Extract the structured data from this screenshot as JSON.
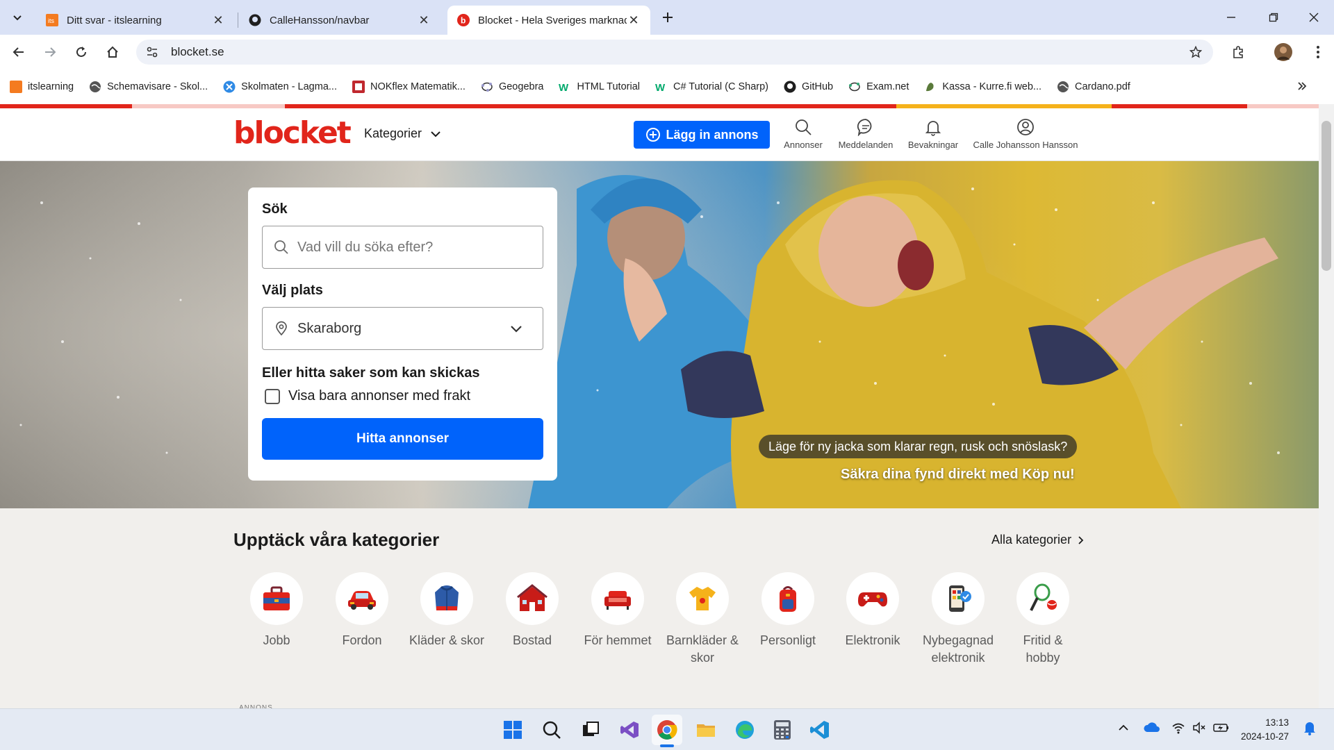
{
  "browser": {
    "tabs": [
      {
        "title": "Ditt svar - itslearning",
        "icon": "itslearning-icon"
      },
      {
        "title": "CalleHansson/navbar",
        "icon": "github-icon"
      },
      {
        "title": "Blocket - Hela Sveriges marknad",
        "icon": "blocket-icon",
        "active": true
      }
    ],
    "url": "blocket.se",
    "bookmarks": [
      {
        "label": "itslearning"
      },
      {
        "label": "Schemavisare - Skol..."
      },
      {
        "label": "Skolmaten - Lagma..."
      },
      {
        "label": "NOKflex Matematik..."
      },
      {
        "label": "Geogebra"
      },
      {
        "label": "HTML Tutorial"
      },
      {
        "label": "C# Tutorial (C Sharp)"
      },
      {
        "label": "GitHub"
      },
      {
        "label": "Exam.net"
      },
      {
        "label": "Kassa - Kurre.fi web..."
      },
      {
        "label": "Cardano.pdf"
      }
    ]
  },
  "header": {
    "logo": "blocket",
    "categories_label": "Kategorier",
    "post_ad_label": "Lägg in annons",
    "nav": [
      {
        "label": "Annonser",
        "icon": "search-icon"
      },
      {
        "label": "Meddelanden",
        "icon": "chat-icon"
      },
      {
        "label": "Bevakningar",
        "icon": "bell-icon"
      },
      {
        "label": "Calle Johansson Hansson",
        "icon": "user-icon"
      }
    ]
  },
  "search": {
    "title": "Sök",
    "placeholder": "Vad vill du söka efter?",
    "location_label": "Välj plats",
    "location_value": "Skaraborg",
    "shipping_heading": "Eller hitta saker som kan skickas",
    "shipping_checkbox_label": "Visa bara annonser med frakt",
    "shipping_checked": false,
    "submit_label": "Hitta annonser"
  },
  "hero": {
    "promo_text": "Läge för ny jacka som klarar regn, rusk och snöslask?",
    "promo_link": "Säkra dina fynd direkt med Köp nu!"
  },
  "categories": {
    "title": "Upptäck våra kategorier",
    "all_label": "Alla kategorier",
    "items": [
      {
        "label": "Jobb",
        "icon": "briefcase-icon"
      },
      {
        "label": "Fordon",
        "icon": "car-icon"
      },
      {
        "label": "Kläder & skor",
        "icon": "jacket-icon"
      },
      {
        "label": "Bostad",
        "icon": "house-icon"
      },
      {
        "label": "För hemmet",
        "icon": "sofa-icon"
      },
      {
        "label": "Barnkläder & skor",
        "icon": "kids-shirt-icon"
      },
      {
        "label": "Personligt",
        "icon": "backpack-icon"
      },
      {
        "label": "Elektronik",
        "icon": "gamepad-icon"
      },
      {
        "label": "Nybegagnad elektronik",
        "icon": "phone-icon"
      },
      {
        "label": "Fritid & hobby",
        "icon": "tennis-icon"
      }
    ]
  },
  "ad_label": "ANNONS",
  "taskbar": {
    "time": "13:13",
    "date": "2024-10-27"
  },
  "colors": {
    "brand_red": "#e1251b",
    "primary_blue": "#0063fb"
  }
}
